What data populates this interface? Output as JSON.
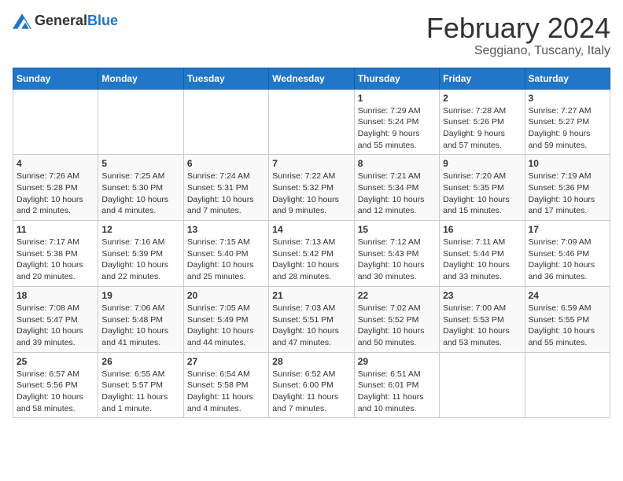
{
  "header": {
    "logo_general": "General",
    "logo_blue": "Blue",
    "title": "February 2024",
    "subtitle": "Seggiano, Tuscany, Italy"
  },
  "calendar": {
    "days_of_week": [
      "Sunday",
      "Monday",
      "Tuesday",
      "Wednesday",
      "Thursday",
      "Friday",
      "Saturday"
    ],
    "weeks": [
      [
        {
          "day": "",
          "info": ""
        },
        {
          "day": "",
          "info": ""
        },
        {
          "day": "",
          "info": ""
        },
        {
          "day": "",
          "info": ""
        },
        {
          "day": "1",
          "info": "Sunrise: 7:29 AM\nSunset: 5:24 PM\nDaylight: 9 hours\nand 55 minutes."
        },
        {
          "day": "2",
          "info": "Sunrise: 7:28 AM\nSunset: 5:26 PM\nDaylight: 9 hours\nand 57 minutes."
        },
        {
          "day": "3",
          "info": "Sunrise: 7:27 AM\nSunset: 5:27 PM\nDaylight: 9 hours\nand 59 minutes."
        }
      ],
      [
        {
          "day": "4",
          "info": "Sunrise: 7:26 AM\nSunset: 5:28 PM\nDaylight: 10 hours\nand 2 minutes."
        },
        {
          "day": "5",
          "info": "Sunrise: 7:25 AM\nSunset: 5:30 PM\nDaylight: 10 hours\nand 4 minutes."
        },
        {
          "day": "6",
          "info": "Sunrise: 7:24 AM\nSunset: 5:31 PM\nDaylight: 10 hours\nand 7 minutes."
        },
        {
          "day": "7",
          "info": "Sunrise: 7:22 AM\nSunset: 5:32 PM\nDaylight: 10 hours\nand 9 minutes."
        },
        {
          "day": "8",
          "info": "Sunrise: 7:21 AM\nSunset: 5:34 PM\nDaylight: 10 hours\nand 12 minutes."
        },
        {
          "day": "9",
          "info": "Sunrise: 7:20 AM\nSunset: 5:35 PM\nDaylight: 10 hours\nand 15 minutes."
        },
        {
          "day": "10",
          "info": "Sunrise: 7:19 AM\nSunset: 5:36 PM\nDaylight: 10 hours\nand 17 minutes."
        }
      ],
      [
        {
          "day": "11",
          "info": "Sunrise: 7:17 AM\nSunset: 5:38 PM\nDaylight: 10 hours\nand 20 minutes."
        },
        {
          "day": "12",
          "info": "Sunrise: 7:16 AM\nSunset: 5:39 PM\nDaylight: 10 hours\nand 22 minutes."
        },
        {
          "day": "13",
          "info": "Sunrise: 7:15 AM\nSunset: 5:40 PM\nDaylight: 10 hours\nand 25 minutes."
        },
        {
          "day": "14",
          "info": "Sunrise: 7:13 AM\nSunset: 5:42 PM\nDaylight: 10 hours\nand 28 minutes."
        },
        {
          "day": "15",
          "info": "Sunrise: 7:12 AM\nSunset: 5:43 PM\nDaylight: 10 hours\nand 30 minutes."
        },
        {
          "day": "16",
          "info": "Sunrise: 7:11 AM\nSunset: 5:44 PM\nDaylight: 10 hours\nand 33 minutes."
        },
        {
          "day": "17",
          "info": "Sunrise: 7:09 AM\nSunset: 5:46 PM\nDaylight: 10 hours\nand 36 minutes."
        }
      ],
      [
        {
          "day": "18",
          "info": "Sunrise: 7:08 AM\nSunset: 5:47 PM\nDaylight: 10 hours\nand 39 minutes."
        },
        {
          "day": "19",
          "info": "Sunrise: 7:06 AM\nSunset: 5:48 PM\nDaylight: 10 hours\nand 41 minutes."
        },
        {
          "day": "20",
          "info": "Sunrise: 7:05 AM\nSunset: 5:49 PM\nDaylight: 10 hours\nand 44 minutes."
        },
        {
          "day": "21",
          "info": "Sunrise: 7:03 AM\nSunset: 5:51 PM\nDaylight: 10 hours\nand 47 minutes."
        },
        {
          "day": "22",
          "info": "Sunrise: 7:02 AM\nSunset: 5:52 PM\nDaylight: 10 hours\nand 50 minutes."
        },
        {
          "day": "23",
          "info": "Sunrise: 7:00 AM\nSunset: 5:53 PM\nDaylight: 10 hours\nand 53 minutes."
        },
        {
          "day": "24",
          "info": "Sunrise: 6:59 AM\nSunset: 5:55 PM\nDaylight: 10 hours\nand 55 minutes."
        }
      ],
      [
        {
          "day": "25",
          "info": "Sunrise: 6:57 AM\nSunset: 5:56 PM\nDaylight: 10 hours\nand 58 minutes."
        },
        {
          "day": "26",
          "info": "Sunrise: 6:55 AM\nSunset: 5:57 PM\nDaylight: 11 hours\nand 1 minute."
        },
        {
          "day": "27",
          "info": "Sunrise: 6:54 AM\nSunset: 5:58 PM\nDaylight: 11 hours\nand 4 minutes."
        },
        {
          "day": "28",
          "info": "Sunrise: 6:52 AM\nSunset: 6:00 PM\nDaylight: 11 hours\nand 7 minutes."
        },
        {
          "day": "29",
          "info": "Sunrise: 6:51 AM\nSunset: 6:01 PM\nDaylight: 11 hours\nand 10 minutes."
        },
        {
          "day": "",
          "info": ""
        },
        {
          "day": "",
          "info": ""
        }
      ]
    ]
  }
}
